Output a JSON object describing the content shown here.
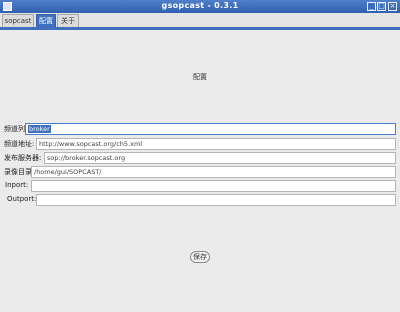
{
  "window": {
    "title": "gsopcast - 0.3.1",
    "minimize_glyph": "_",
    "maximize_glyph": "□",
    "close_glyph": "×"
  },
  "tabs": [
    {
      "label": "sopcast",
      "active": false
    },
    {
      "label": "配置",
      "active": true
    },
    {
      "label": "关于",
      "active": false
    }
  ],
  "settings": {
    "status_label": "配置",
    "fields": [
      {
        "label": "频道列表",
        "value": "broker"
      },
      {
        "label": "频道地址:",
        "value": "http://www.sopcast.org/ch5.xml"
      },
      {
        "label": "发布服务器:",
        "value": "sop://broker.sopcast.org"
      },
      {
        "label": "录像目录:",
        "value": "/home/gui/SOPCAST/"
      },
      {
        "label": "Inport:",
        "value": ""
      },
      {
        "label": "Outport:",
        "value": ""
      }
    ],
    "save_label": "保存"
  },
  "colors": {
    "accent": "#3f6fbd",
    "titlebar": "#2f5fae",
    "background": "#ebebeb"
  }
}
